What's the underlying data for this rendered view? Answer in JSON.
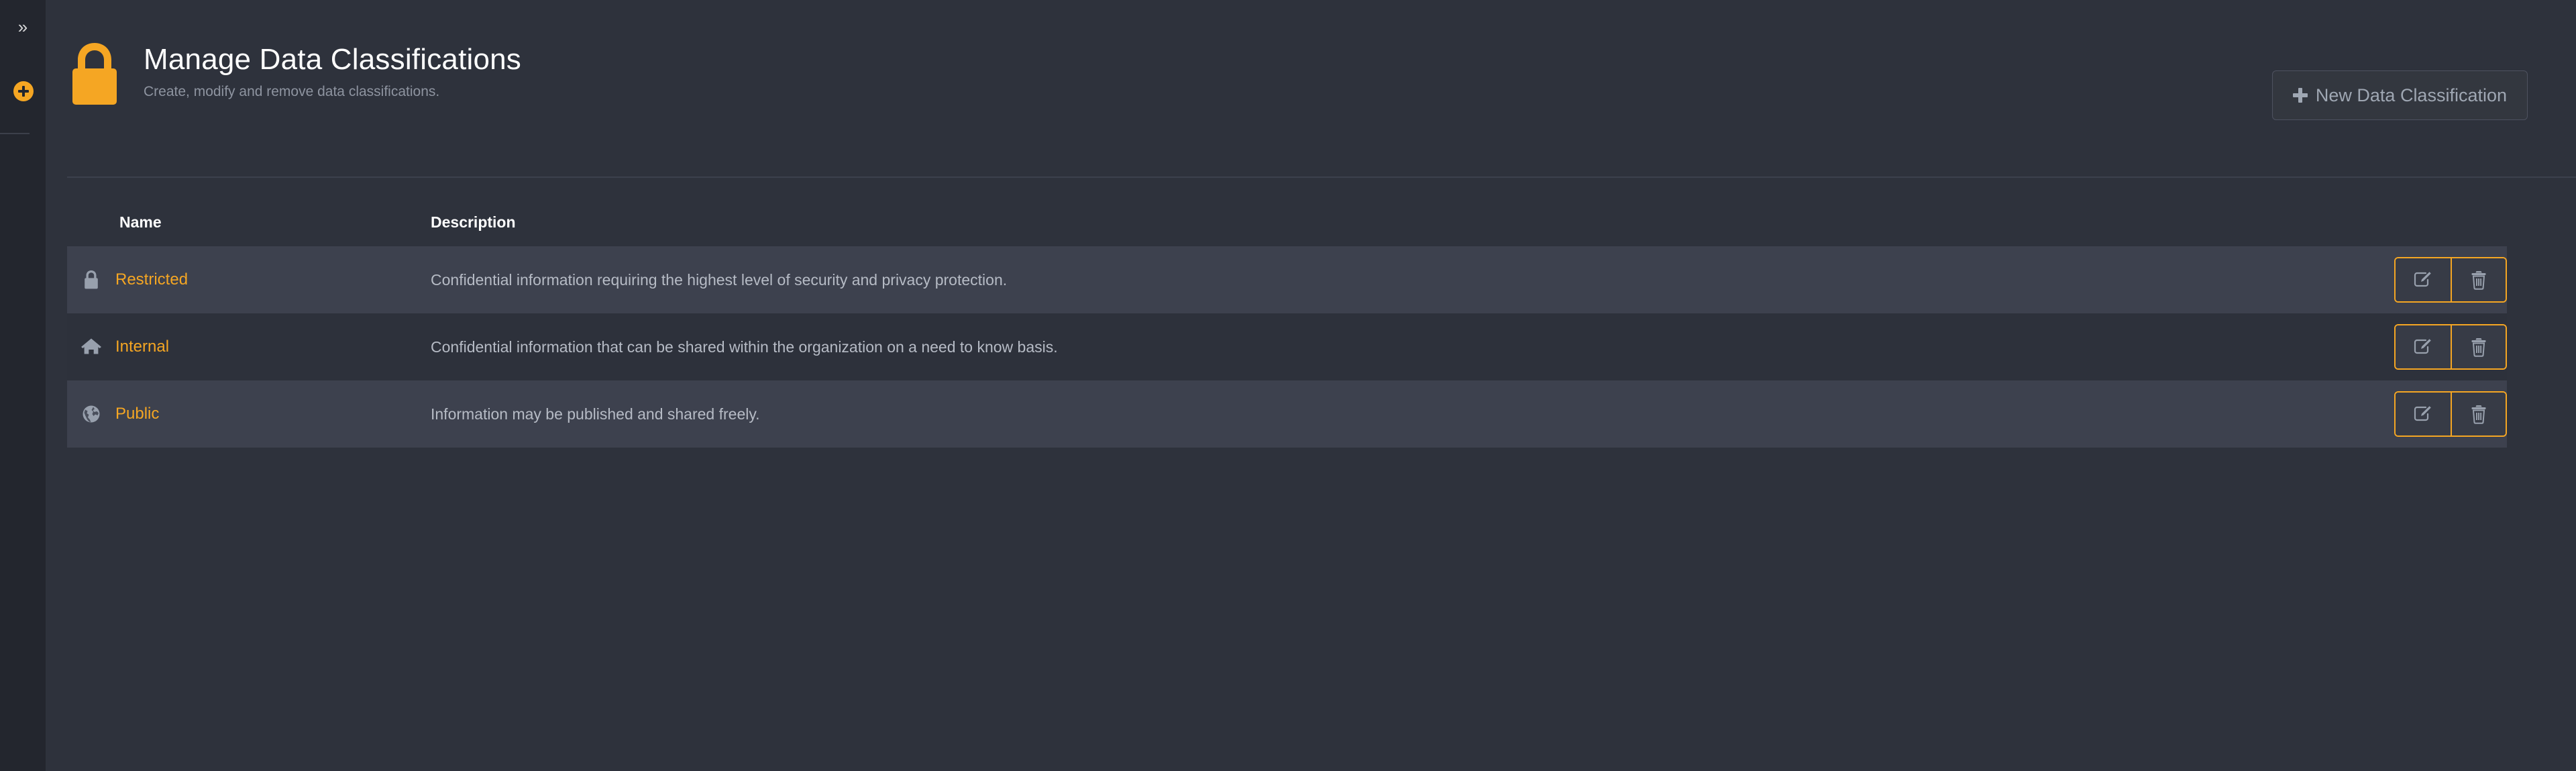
{
  "sidebar": {
    "expand_icon": "chevrons-right-icon",
    "expand_label": "»",
    "add_icon": "plus-circle-icon",
    "accent_color": "#f5a623",
    "background_color": "#23262e"
  },
  "header": {
    "brand_icon": "padlock-icon",
    "title": "Manage Data Classifications",
    "subtitle": "Create, modify and remove data classifications.",
    "new_button": {
      "icon": "plus-icon",
      "label": "New Data Classification"
    }
  },
  "table": {
    "columns": [
      {
        "key": "icon",
        "label": ""
      },
      {
        "key": "name",
        "label": "Name"
      },
      {
        "key": "description",
        "label": "Description"
      },
      {
        "key": "actions",
        "label": ""
      }
    ],
    "rows": [
      {
        "icon": "lock-icon",
        "name": "Restricted",
        "description": "Confidential information requiring the highest level of security and privacy protection.",
        "edit_icon": "edit-pencil-icon",
        "delete_icon": "trash-icon"
      },
      {
        "icon": "home-icon",
        "name": "Internal",
        "description": "Confidential information that can be shared within the organization on a need to know basis.",
        "edit_icon": "edit-pencil-icon",
        "delete_icon": "trash-icon"
      },
      {
        "icon": "globe-icon",
        "name": "Public",
        "description": "Information may be published and shared freely.",
        "edit_icon": "edit-pencil-icon",
        "delete_icon": "trash-icon"
      }
    ]
  },
  "colors": {
    "page_background": "#2e323c",
    "sidebar_background": "#23262e",
    "accent": "#f5a623",
    "row_odd": "#3d414e",
    "row_even": "#2d313b",
    "name_link": "#f5a623",
    "description_text": "#b6bbc5",
    "muted_text": "#8e94a0"
  }
}
